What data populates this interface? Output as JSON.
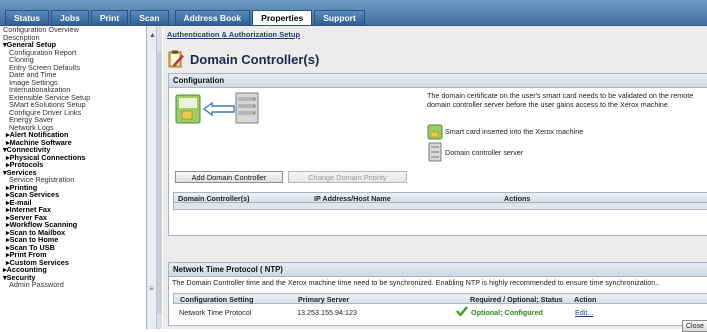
{
  "tabs": [
    {
      "label": "Status",
      "active": false
    },
    {
      "label": "Jobs",
      "active": false
    },
    {
      "label": "Print",
      "active": false
    },
    {
      "label": "Scan",
      "active": false
    },
    {
      "label": "Address Book",
      "active": false
    },
    {
      "label": "Properties",
      "active": true
    },
    {
      "label": "Support",
      "active": false
    }
  ],
  "nav": [
    {
      "label": "Configuration Overview",
      "lvl": "l0"
    },
    {
      "label": "Description",
      "lvl": "l0"
    },
    {
      "label": "▾General Setup",
      "lvl": "grp"
    },
    {
      "label": "Configuration Report",
      "lvl": "l1"
    },
    {
      "label": "Cloning",
      "lvl": "l1"
    },
    {
      "label": "Entry Screen Defaults",
      "lvl": "l1"
    },
    {
      "label": "Date and Time",
      "lvl": "l1"
    },
    {
      "label": "Image Settings",
      "lvl": "l1"
    },
    {
      "label": "Internationalization",
      "lvl": "l1"
    },
    {
      "label": "Extensible Service Setup",
      "lvl": "l1"
    },
    {
      "label": "SMart eSolutions Setup",
      "lvl": "l1"
    },
    {
      "label": "Configure Driver Links",
      "lvl": "l1"
    },
    {
      "label": "Energy Saver",
      "lvl": "l1"
    },
    {
      "label": "Network Logs",
      "lvl": "l1"
    },
    {
      "label": "▸Alert Notification",
      "lvl": "sub"
    },
    {
      "label": "▸Machine Software",
      "lvl": "sub"
    },
    {
      "label": "▾Connectivity",
      "lvl": "grp"
    },
    {
      "label": "▸Physical Connections",
      "lvl": "sub"
    },
    {
      "label": "▸Protocols",
      "lvl": "sub"
    },
    {
      "label": "▾Services",
      "lvl": "grp"
    },
    {
      "label": "Service Registration",
      "lvl": "l1"
    },
    {
      "label": "▸Printing",
      "lvl": "sub"
    },
    {
      "label": "▸Scan Services",
      "lvl": "sub"
    },
    {
      "label": "▸E-mail",
      "lvl": "sub"
    },
    {
      "label": "▸Internet Fax",
      "lvl": "sub"
    },
    {
      "label": "▸Server Fax",
      "lvl": "sub"
    },
    {
      "label": "▸Workflow Scanning",
      "lvl": "sub"
    },
    {
      "label": "▸Scan to Mailbox",
      "lvl": "sub"
    },
    {
      "label": "▸Scan to Home",
      "lvl": "sub"
    },
    {
      "label": "▸Scan To USB",
      "lvl": "sub"
    },
    {
      "label": "▸Print From",
      "lvl": "sub"
    },
    {
      "label": "▸Custom Services",
      "lvl": "sub"
    },
    {
      "label": "▸Accounting",
      "lvl": "grp"
    },
    {
      "label": "▾Security",
      "lvl": "grp"
    },
    {
      "label": "Admin Password",
      "lvl": "l1"
    }
  ],
  "breadcrumb": "Authentication & Authorization Setup",
  "page_title": "Domain Controller(s)",
  "configuration": {
    "header": "Configuration",
    "description": "The domain certificate on the user's smart card needs to be validated on the remote domain controller server before the user gains access to the Xerox machine.",
    "legend_smartcard": "Smart card inserted into the Xerox machine",
    "legend_server": "Domain controller server",
    "add_button": "Add Domain Controller",
    "priority_button": "Change Domain Priority",
    "columns": [
      "Domain Controller(s)",
      "IP Address/Host Name",
      "Actions"
    ]
  },
  "ntp": {
    "header": "Network Time Protocol ( NTP)",
    "description": "The Domain Controller time and the Xerox machine time need to be synchronized. Enabling NTP is highly recommended to ensure time synchronization..",
    "columns": [
      "Configuration Setting",
      "Primary Server",
      "Required / Optional; Status",
      "Action"
    ],
    "row": {
      "setting": "Network Time Protocol",
      "server": "13.253.155.94:123",
      "status": "Optional; Configured",
      "action": "Edit..."
    }
  },
  "close_label": "Close",
  "colors": {
    "accent": "#3f6f9e",
    "link": "#1d3f7a",
    "ok": "#2f8a1d"
  }
}
